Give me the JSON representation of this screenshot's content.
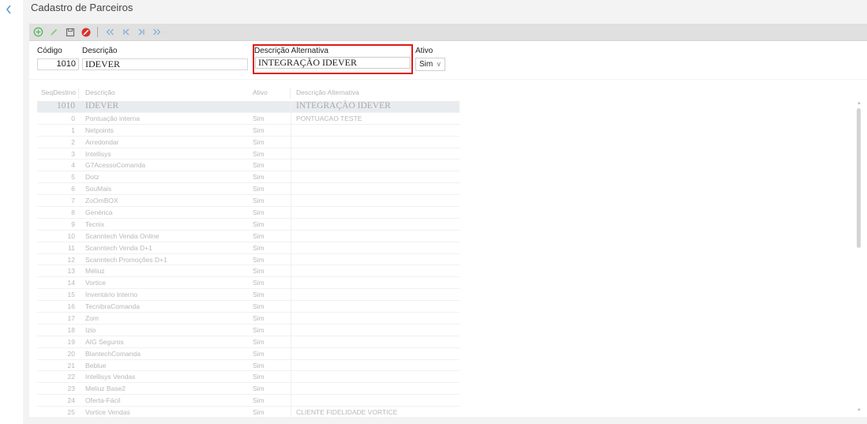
{
  "page": {
    "title": "Cadastro de Parceiros"
  },
  "nav": {
    "back_icon": "chevron-left-icon"
  },
  "toolbar": {
    "buttons": [
      {
        "name": "add-button",
        "icon": "plus-circle-icon",
        "color": "#5cb85c"
      },
      {
        "name": "edit-button",
        "icon": "pencil-icon",
        "color": "#7ccf6c"
      },
      {
        "name": "save-button",
        "icon": "floppy-icon",
        "color": "#666666"
      },
      {
        "name": "cancel-button",
        "icon": "ban-icon",
        "color": "#d9302c"
      },
      {
        "name": "first-record-button",
        "icon": "double-left-icon",
        "color": "#7fa7d4"
      },
      {
        "name": "previous-record-button",
        "icon": "step-left-icon",
        "color": "#7fa7d4"
      },
      {
        "name": "next-record-button",
        "icon": "step-right-icon",
        "color": "#7fa7d4"
      },
      {
        "name": "last-record-button",
        "icon": "double-right-icon",
        "color": "#7fa7d4"
      }
    ]
  },
  "form": {
    "codigo_label": "Código",
    "codigo_value": "1010",
    "descricao_label": "Descrição",
    "descricao_value": "IDEVER",
    "desc_alt_label": "Descrição Alternativa",
    "desc_alt_value": "INTEGRAÇÃO IDEVER",
    "ativo_label": "Ativo",
    "ativo_value": "Sim",
    "highlight_color": "#e01919"
  },
  "grid": {
    "columns": [
      "SeqDestino",
      "Descrição",
      "Ativo",
      "Descrição Alternativa"
    ],
    "rows": [
      {
        "seq": "1010",
        "desc": "IDEVER",
        "ativo": "",
        "alt": "INTEGRAÇÃO IDEVER",
        "selected": true
      },
      {
        "seq": "0",
        "desc": "Pontuação interna",
        "ativo": "Sim",
        "alt": "PONTUACAO TESTE"
      },
      {
        "seq": "1",
        "desc": "Netpoints",
        "ativo": "Sim",
        "alt": ""
      },
      {
        "seq": "2",
        "desc": "Arredondar",
        "ativo": "Sim",
        "alt": ""
      },
      {
        "seq": "3",
        "desc": "Intellisys",
        "ativo": "Sim",
        "alt": ""
      },
      {
        "seq": "4",
        "desc": "G7AcessoComanda",
        "ativo": "Sim",
        "alt": ""
      },
      {
        "seq": "5",
        "desc": "Dotz",
        "ativo": "Sim",
        "alt": ""
      },
      {
        "seq": "6",
        "desc": "SouMais",
        "ativo": "Sim",
        "alt": ""
      },
      {
        "seq": "7",
        "desc": "ZoOmBOX",
        "ativo": "Sim",
        "alt": ""
      },
      {
        "seq": "8",
        "desc": "Genérica",
        "ativo": "Sim",
        "alt": ""
      },
      {
        "seq": "9",
        "desc": "Tecnix",
        "ativo": "Sim",
        "alt": ""
      },
      {
        "seq": "10",
        "desc": "Scanntech Venda Online",
        "ativo": "Sim",
        "alt": ""
      },
      {
        "seq": "11",
        "desc": "Scanntech Venda D+1",
        "ativo": "Sim",
        "alt": ""
      },
      {
        "seq": "12",
        "desc": "Scanntech Promoções D+1",
        "ativo": "Sim",
        "alt": ""
      },
      {
        "seq": "13",
        "desc": "Méliuz",
        "ativo": "Sim",
        "alt": ""
      },
      {
        "seq": "14",
        "desc": "Vortice",
        "ativo": "Sim",
        "alt": ""
      },
      {
        "seq": "15",
        "desc": "Inventário Interno",
        "ativo": "Sim",
        "alt": ""
      },
      {
        "seq": "16",
        "desc": "TecnibraComanda",
        "ativo": "Sim",
        "alt": ""
      },
      {
        "seq": "17",
        "desc": "Zom",
        "ativo": "Sim",
        "alt": ""
      },
      {
        "seq": "18",
        "desc": "Izio",
        "ativo": "Sim",
        "alt": ""
      },
      {
        "seq": "19",
        "desc": "AIG Seguros",
        "ativo": "Sim",
        "alt": ""
      },
      {
        "seq": "20",
        "desc": "BlantechComanda",
        "ativo": "Sim",
        "alt": ""
      },
      {
        "seq": "21",
        "desc": "Beblue",
        "ativo": "Sim",
        "alt": ""
      },
      {
        "seq": "22",
        "desc": "Intellisys Vendas",
        "ativo": "Sim",
        "alt": ""
      },
      {
        "seq": "23",
        "desc": "Meliuz Base2",
        "ativo": "Sim",
        "alt": ""
      },
      {
        "seq": "24",
        "desc": "Oferta-Fácil",
        "ativo": "Sim",
        "alt": ""
      },
      {
        "seq": "25",
        "desc": "Vortice Vendas",
        "ativo": "Sim",
        "alt": "CLIENTE FIDELIDADE VORTICE"
      }
    ]
  }
}
